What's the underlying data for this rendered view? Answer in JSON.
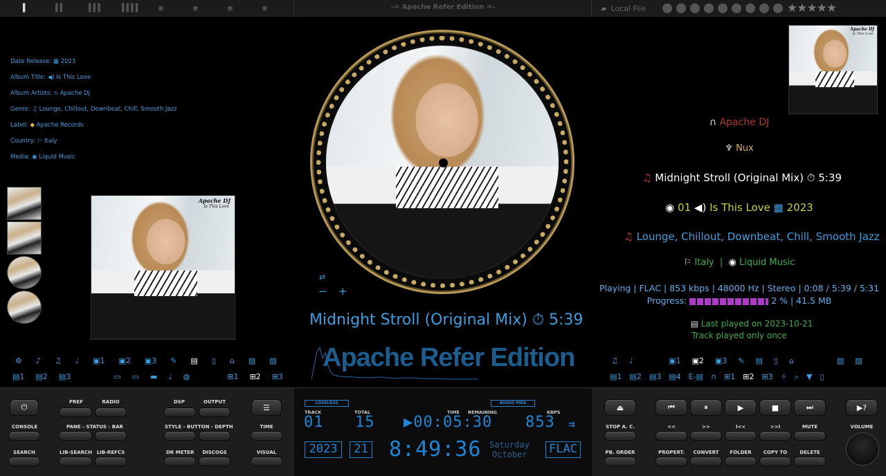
{
  "topbar": {
    "title": "-= Apache Refer Edition =-",
    "local_file": "Local File",
    "layout_icons": [
      "I",
      "II",
      "III",
      "IIII",
      "▣",
      "▣",
      "▣",
      "▣"
    ],
    "service_icons": [
      "link-icon",
      "google-icon",
      "lastfm-icon",
      "youtube-icon",
      "soundcloud-icon",
      "spotify-icon",
      "discogs-icon",
      "wikipedia-icon",
      "podcast-icon"
    ],
    "rating_stars": 5
  },
  "info": {
    "date_label": "Date Release:",
    "date": "2023",
    "album_label": "Album Title:",
    "album": "Is This Love",
    "artists_label": "Album Artists:",
    "artists": "Apache DJ",
    "genre_label": "Genre:",
    "genre": "Lounge, Chillout, Downbeat, Chill, Smooth Jazz",
    "label_label": "Label:",
    "label": "Apache Records",
    "country_label": "Country:",
    "country": "Italy",
    "media_label": "Media:",
    "media": "Liquid Music"
  },
  "cover": {
    "artist_text": "Apache DJ",
    "album_text": "Is This Love"
  },
  "now_playing": {
    "title": "Midnight Stroll (Original Mix)",
    "duration": "5:39",
    "watermark": "Apache Refer Edition"
  },
  "right": {
    "artist": "Apache DJ",
    "composer": "Nux",
    "track": "Midnight Stroll (Original Mix)",
    "duration": "5:39",
    "disc": "01",
    "album": "Is This Love",
    "year": "2023",
    "genre": "Lounge, Chillout, Downbeat, Chill, Smooth Jazz",
    "country": "Italy",
    "media": "Liquid Music",
    "status": "Playing | FLAC | 853 kbps | 48000 Hz | Stereo | 0:08 / 5:39 / 5:31",
    "progress_label": "Progress:",
    "progress_pct": 2,
    "progress_text": "2 % | 41.5 MB",
    "last_played": "Last played on 2023-10-21",
    "play_count_text": "Track played only once"
  },
  "left_buttons": {
    "pref": "PREF",
    "radio": "RADIO",
    "dsp": "DSP",
    "output": "OUTPUT",
    "console": "CONSOLE",
    "pane": "PANE - STATUS - BAR",
    "style": "STYLE - BUTTON - DEPTH",
    "time": "TIME",
    "search": "SEARCH",
    "lib_search": "LIB-SEARCH",
    "lib_refcs": "LIB-REFCS",
    "dr_meter": "DR METER",
    "discogs": "DISCOGS",
    "visual": "VISUAL"
  },
  "lcd": {
    "lossless": "LOSSLESS",
    "audio_mds": "AUDIO MDS",
    "track_label": "TRACK",
    "total_label": "TOTAL",
    "time_label": "TIME",
    "remaining_label": "REMAINING",
    "kbps_label": "KBPS",
    "track": "01",
    "total": "15",
    "time": "▶00:05:30",
    "kbps": "853",
    "year": "2023",
    "day": "21",
    "clock": "8:49:36",
    "weekday": "Saturday",
    "month": "October",
    "format": "FLAC"
  },
  "right_buttons": {
    "stop_ac": "STOP A. C.",
    "prev": "<<",
    "next": ">>",
    "first": "I<<",
    "last": ">>I",
    "mute": "MUTE",
    "volume": "VOLUME",
    "pb_order": "PB. ORDER",
    "properties": "PROPERT.",
    "convert": "CONVERT",
    "folder": "FOLDER",
    "copy_to": "COPY TO",
    "delete": "DELETE"
  },
  "colors": {
    "accent": "#3a9fe0",
    "artist": "#b5372a",
    "composer": "#e0b060",
    "album": "#c7d42e",
    "country": "#39b04a",
    "progress": "#b03ac8"
  }
}
